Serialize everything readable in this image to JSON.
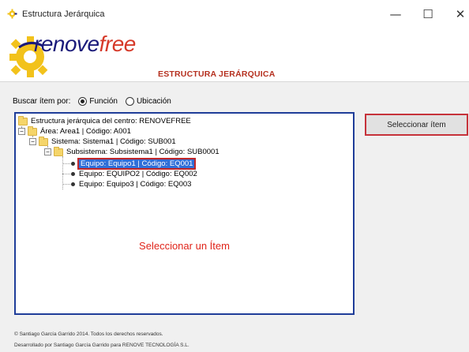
{
  "window": {
    "title": "Estructura Jerárquica",
    "minimize": "—",
    "maximize": "☐",
    "close": "✕"
  },
  "header": {
    "logo_part1": "renove",
    "logo_part2": "free",
    "subtitle": "ESTRUCTURA JERÁRQUICA",
    "colors": {
      "brand_blue": "#1a1a7a",
      "brand_red": "#d63a2a",
      "gear_yellow": "#f2c21b"
    }
  },
  "search": {
    "label": "Buscar ítem por:",
    "options": [
      {
        "label": "Función",
        "checked": true
      },
      {
        "label": "Ubicación",
        "checked": false
      }
    ]
  },
  "tree": {
    "root": "Estructura jerárquica del centro: RENOVEFREE",
    "area": "Área: Area1 | Código: A001",
    "sistema": "Sistema: Sistema1 | Código: SUB001",
    "subsistema": "Subsistema: Subsistema1 | Código: SUB0001",
    "equipos": [
      "Equipo: Equipo1 | Código: EQ001",
      "Equipo: EQUIPO2 | Código: EQ002",
      "Equipo: Equipo3 | Código: EQ003"
    ],
    "selected_index": 0,
    "hint": "Seleccionar un Ítem"
  },
  "actions": {
    "select_label": "Seleccionar ítem"
  },
  "footer": {
    "copyright": "© Santiago García Garrido 2014. Todos los derechos reservados.",
    "developer": "Desarrollado por Santiago García Garrido para RENOVE TECNOLOGÍA S.L."
  }
}
